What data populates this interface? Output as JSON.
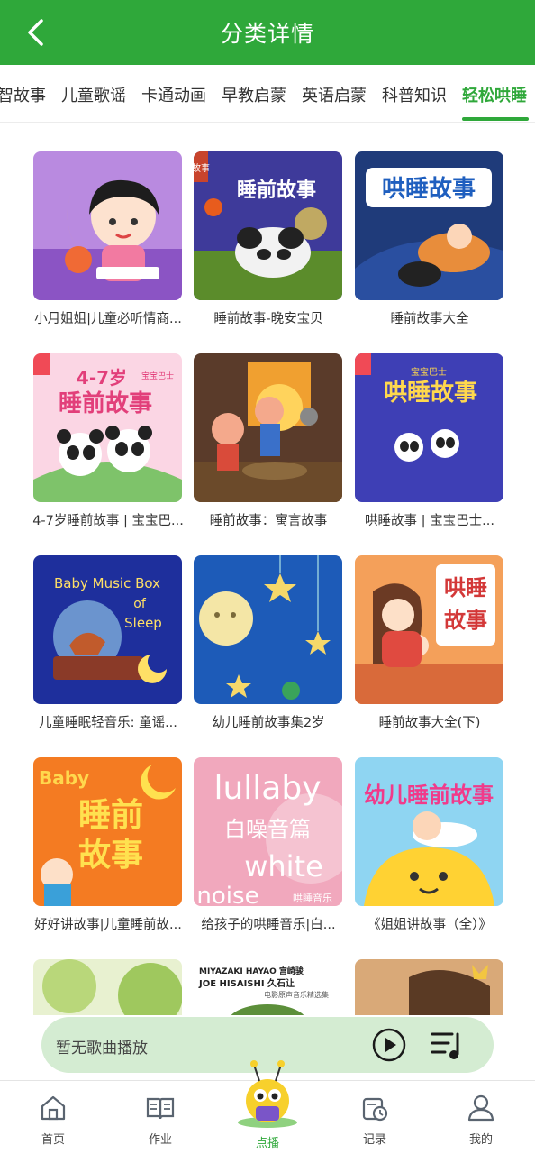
{
  "header": {
    "title": "分类详情"
  },
  "tabs": [
    "智故事",
    "儿童歌谣",
    "卡通动画",
    "早教启蒙",
    "英语启蒙",
    "科普知识",
    "轻松哄睡"
  ],
  "active_tab_index": 6,
  "cover_texts": {
    "c2_title": "睡前故事",
    "c2_tag": "故事",
    "c3_title": "哄睡故事",
    "c4_age": "4-7岁",
    "c4_brand": "宝宝巴士",
    "c4_title": "睡前故事",
    "c6_brand": "宝宝巴士",
    "c6_title": "哄睡故事",
    "c7_line1": "Baby Music Box",
    "c7_line2": "of",
    "c7_line3": "Sleep",
    "c9_line1": "哄睡",
    "c9_line2": "故事",
    "c10_baby": "Baby",
    "c10_line1": "睡前",
    "c10_line2": "故事",
    "c11_line1": "lullaby",
    "c11_line2": "白噪音篇",
    "c11_line3": "white",
    "c11_line4": "noise",
    "c11_tag": "哄睡音乐",
    "c12_title": "幼儿睡前故事",
    "c14_line1": "MIYAZAKI HAYAO 宫崎骏",
    "c14_line2": "JOE HISAISHI 久石让",
    "c14_line3": "电影原声音乐精选集"
  },
  "cards": [
    {
      "caption": "小月姐姐|儿童必听情商..."
    },
    {
      "caption": "睡前故事-晚安宝贝"
    },
    {
      "caption": "睡前故事大全"
    },
    {
      "caption": "4-7岁睡前故事 | 宝宝巴..."
    },
    {
      "caption": "睡前故事：寓言故事"
    },
    {
      "caption": "哄睡故事 | 宝宝巴士..."
    },
    {
      "caption": "儿童睡眠轻音乐: 童谣..."
    },
    {
      "caption": "幼儿睡前故事集2岁"
    },
    {
      "caption": "睡前故事大全(下)"
    },
    {
      "caption": "好好讲故事|儿童睡前故..."
    },
    {
      "caption": "给孩子的哄睡音乐|白..."
    },
    {
      "caption": "《姐姐讲故事（全）》"
    }
  ],
  "player": {
    "status_text": "暂无歌曲播放"
  },
  "nav": [
    {
      "label": "首页",
      "icon": "home-icon"
    },
    {
      "label": "作业",
      "icon": "book-icon"
    },
    {
      "label": "点播",
      "icon": "mascot-icon"
    },
    {
      "label": "记录",
      "icon": "history-icon"
    },
    {
      "label": "我的",
      "icon": "user-icon"
    }
  ],
  "colors": {
    "brand_green": "#2fa83a",
    "player_bg": "#d4ecd2"
  }
}
